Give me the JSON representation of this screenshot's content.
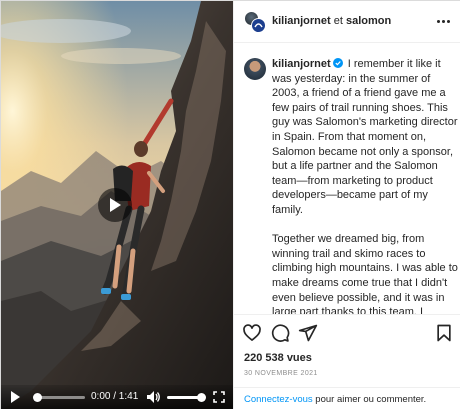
{
  "post": {
    "header": {
      "username": "kilianjornet",
      "conjunction": "et",
      "partner": "salomon"
    },
    "caption": {
      "username": "kilianjornet",
      "paragraph1": "I remember it like it was yesterday: in the summer of 2003, a friend of a friend gave me a few pairs of trail running shoes. This guy was Salomon's marketing director in Spain. From that moment on, Salomon became not only a sponsor, but a life partner and the Salomon team—from marketing to product developers—became part of my family.",
      "paragraph2": "Together we dreamed big, from winning trail and skimo races to climbing high mountains. I was able to make dreams come true that I didn't even believe possible, and it was in large part thanks to this team. I cannot express the gratitude I have towards Salomon for having accompanied me for more than half of my life."
    },
    "views": "220 538 vues",
    "date": "30 NOVEMBRE 2021",
    "login": {
      "link": "Connectez-vous",
      "rest": " pour aimer ou commenter."
    }
  },
  "video": {
    "time": "0:00 / 1:41",
    "progress": 0,
    "volume": 1
  },
  "icons": {
    "verified_color": "#0095f6",
    "link_color": "#0095f6"
  }
}
